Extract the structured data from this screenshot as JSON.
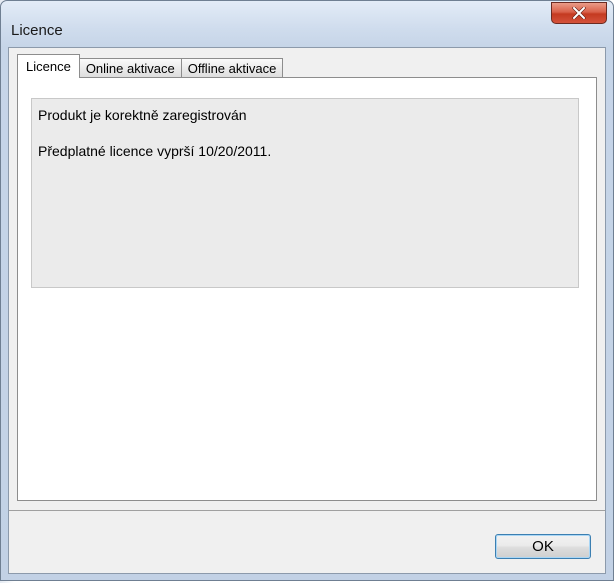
{
  "window": {
    "title": "Licence"
  },
  "tabs": [
    {
      "label": "Licence",
      "active": true
    },
    {
      "label": "Online aktivace",
      "active": false
    },
    {
      "label": "Offline aktivace",
      "active": false
    }
  ],
  "panel": {
    "status": "Produkt je korektně zaregistrován",
    "expiry": "Předplatné licence vyprší 10/20/2011."
  },
  "buttons": {
    "ok_label": "OK"
  },
  "icons": {
    "close": "close-icon"
  },
  "colors": {
    "title_bar": "#cfdced",
    "close_button": "#c43a21",
    "ok_focus_border": "#3c7fb1"
  }
}
